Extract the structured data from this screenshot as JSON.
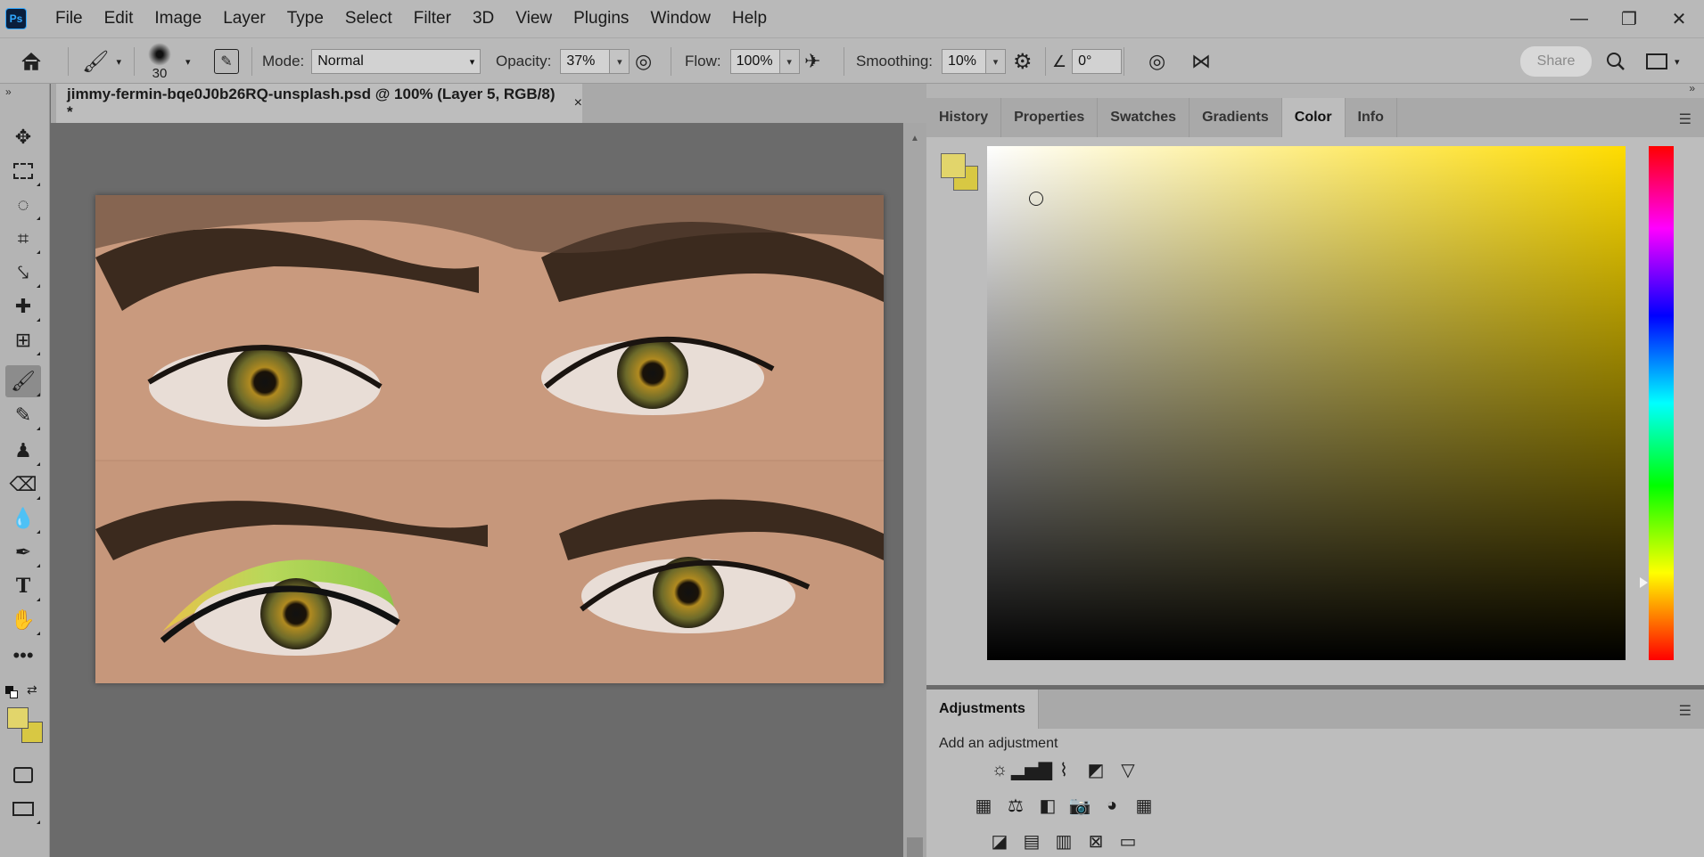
{
  "app": {
    "logo": "Ps"
  },
  "menu": [
    "File",
    "Edit",
    "Image",
    "Layer",
    "Type",
    "Select",
    "Filter",
    "3D",
    "View",
    "Plugins",
    "Window",
    "Help"
  ],
  "window_controls": {
    "minimize": "—",
    "restore": "❐",
    "close": "✕"
  },
  "options": {
    "brush_size": "30",
    "mode_label": "Mode:",
    "mode_value": "Normal",
    "opacity_label": "Opacity:",
    "opacity_value": "37%",
    "flow_label": "Flow:",
    "flow_value": "100%",
    "smoothing_label": "Smoothing:",
    "smoothing_value": "10%",
    "angle_value": "0°",
    "share_label": "Share"
  },
  "document": {
    "tab_title": "jimmy-fermin-bqe0J0b26RQ-unsplash.psd @ 100% (Layer 5, RGB/8) *",
    "close": "×"
  },
  "tools": [
    "move-icon",
    "marquee-icon",
    "quick-select-icon",
    "crop-icon",
    "eyedropper-icon",
    "healing-icon",
    "patch-icon",
    "brush-icon",
    "mixer-brush-icon",
    "stamp-icon",
    "eraser-icon",
    "blur-icon",
    "pen-icon",
    "type-icon",
    "hand-icon",
    "more-icon"
  ],
  "colors": {
    "foreground": "#e2d56b",
    "background": "#d8c843",
    "hue_base": "#ffdc00"
  },
  "panel_tabs": [
    "History",
    "Properties",
    "Swatches",
    "Gradients",
    "Color",
    "Info"
  ],
  "active_panel_tab": "Color",
  "adjustments": {
    "tab": "Adjustments",
    "hint": "Add an adjustment"
  }
}
